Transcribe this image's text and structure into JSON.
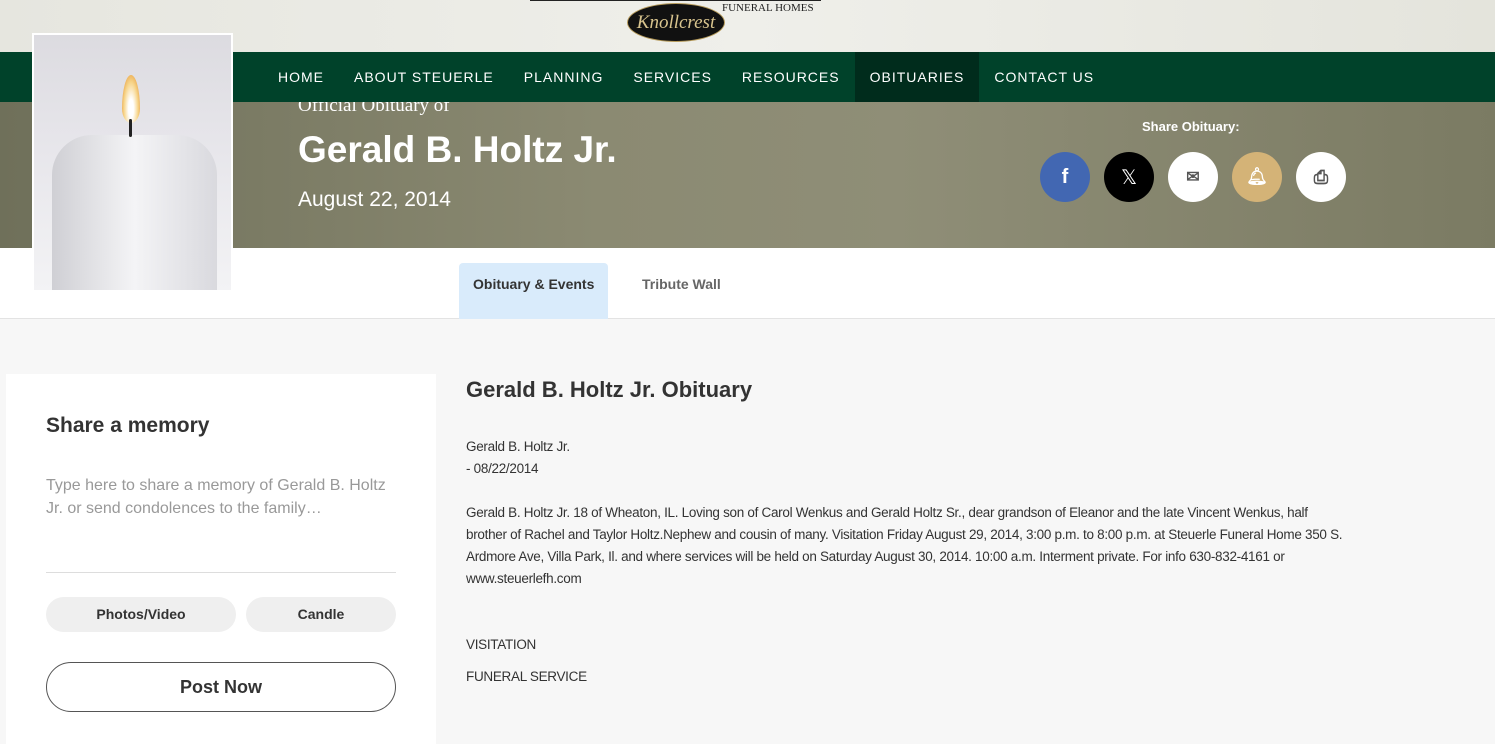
{
  "header": {
    "logo_text": "Knollcrest",
    "logo_sub": "FUNERAL HOMES"
  },
  "nav": [
    "HOME",
    "ABOUT STEUERLE",
    "PLANNING",
    "SERVICES",
    "RESOURCES",
    "OBITUARIES",
    "CONTACT US"
  ],
  "nav_active": "OBITUARIES",
  "hero": {
    "official": "Official Obituary of",
    "name": "Gerald B. Holtz Jr.",
    "date": "August 22, 2014",
    "share_label": "Share Obituary:"
  },
  "share_icons": [
    "facebook-icon",
    "x-icon",
    "email-icon",
    "bell-icon",
    "print-icon"
  ],
  "colors": {
    "nav": "#00422a",
    "facebook": "#4267b2",
    "bell": "#d4b377",
    "tab_active": "#d9ebfb"
  },
  "tabs": [
    "Obituary & Events",
    "Tribute Wall"
  ],
  "memory": {
    "title": "Share a memory",
    "placeholder": "Type here to share a memory of Gerald B. Holtz Jr. or send condolences to the family…",
    "photos": "Photos/Video",
    "candle": "Candle",
    "post": "Post Now"
  },
  "obituary": {
    "title": "Gerald B. Holtz Jr. Obituary",
    "line1": "Gerald B. Holtz Jr.",
    "line2": "- 08/22/2014",
    "body": "Gerald B. Holtz Jr. 18 of Wheaton, IL. Loving son of Carol Wenkus and Gerald Holtz Sr., dear grandson of Eleanor and the late Vincent Wenkus, half brother of Rachel and Taylor Holtz.Nephew and cousin of many. Visitation Friday August 29, 2014, 3:00 p.m. to 8:00 p.m. at Steuerle Funeral Home 350 S. Ardmore Ave, Villa Park, Il. and where services will be held on Saturday August 30, 2014. 10:00 a.m. Interment private. For info 630-832-4161 or www.steuerlefh.com",
    "events": [
      "VISITATION",
      "FUNERAL SERVICE"
    ]
  }
}
